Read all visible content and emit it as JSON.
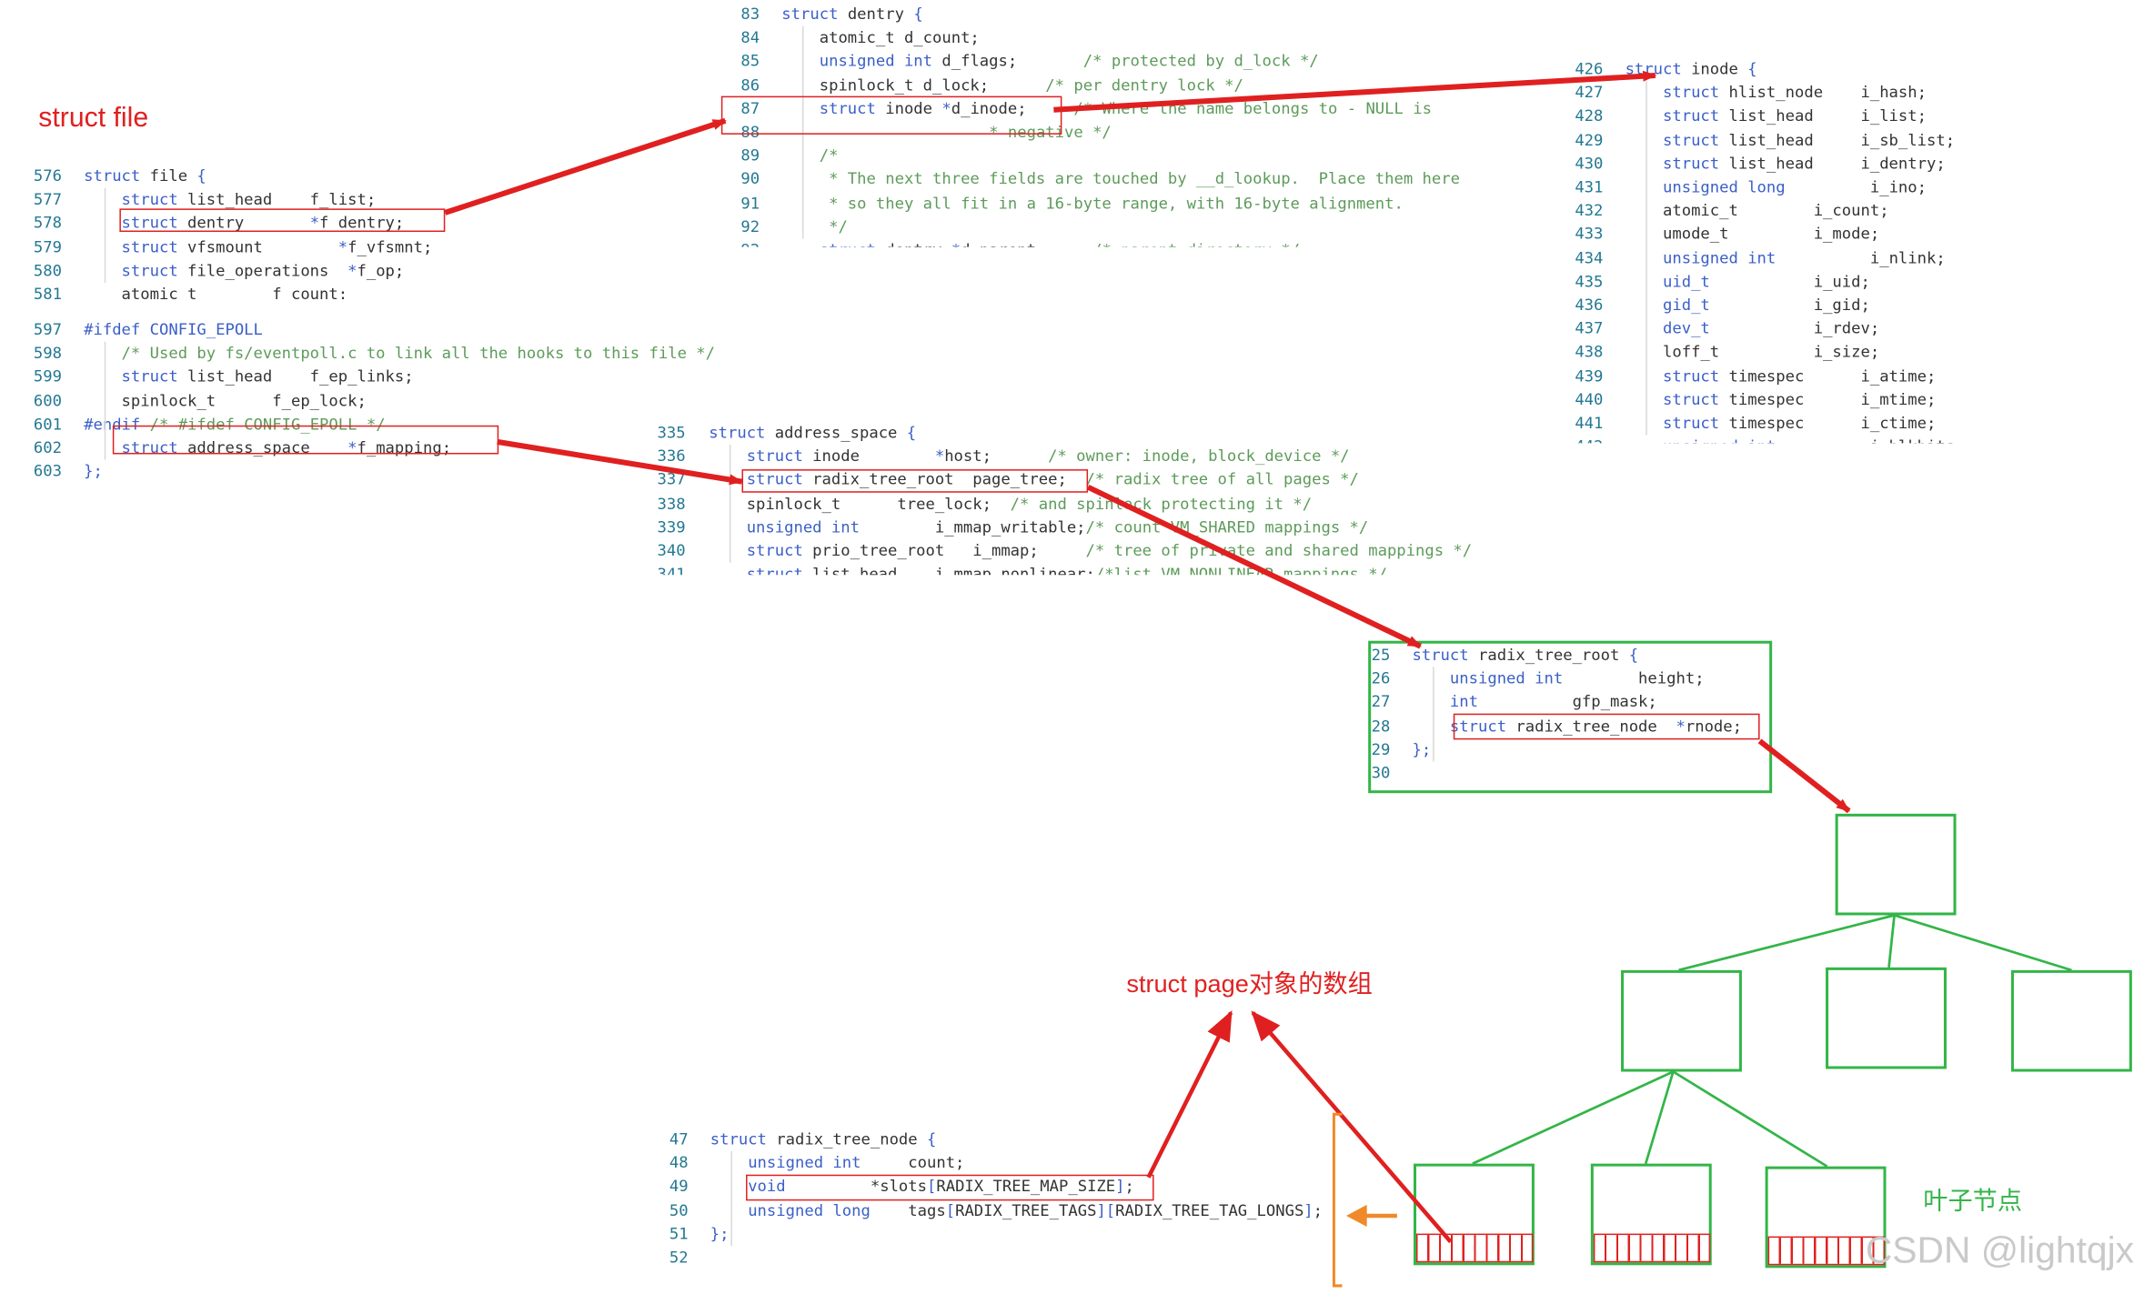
{
  "labels": {
    "struct_file": "struct file",
    "page_array": "struct page对象的数组",
    "leaf_nodes": "叶子节点",
    "watermark": "CSDN @lightqjx"
  },
  "code_blocks": {
    "file_top": [
      {
        "num": "576",
        "parts": [
          {
            "t": "struct",
            "c": "kw"
          },
          {
            "t": " file ",
            "c": ""
          },
          {
            "t": "{",
            "c": "kw"
          }
        ]
      },
      {
        "num": "577",
        "parts": [
          {
            "t": "    struct",
            "c": "kw"
          },
          {
            "t": " list_head    f_list;",
            "c": ""
          }
        ]
      },
      {
        "num": "578",
        "parts": [
          {
            "t": "    struct",
            "c": "kw"
          },
          {
            "t": " dentry       ",
            "c": ""
          },
          {
            "t": "*",
            "c": "kw"
          },
          {
            "t": "f_dentry;",
            "c": ""
          }
        ]
      },
      {
        "num": "579",
        "parts": [
          {
            "t": "    struct",
            "c": "kw"
          },
          {
            "t": " vfsmount        ",
            "c": ""
          },
          {
            "t": "*",
            "c": "kw"
          },
          {
            "t": "f_vfsmnt;",
            "c": ""
          }
        ]
      },
      {
        "num": "580",
        "parts": [
          {
            "t": "    struct",
            "c": "kw"
          },
          {
            "t": " file_operations  ",
            "c": ""
          },
          {
            "t": "*",
            "c": "kw"
          },
          {
            "t": "f_op;",
            "c": ""
          }
        ]
      },
      {
        "num": "581",
        "parts": [
          {
            "t": "    atomic_t        f_count;",
            "c": ""
          }
        ]
      }
    ],
    "file_bottom": [
      {
        "num": "597",
        "parts": [
          {
            "t": "#ifdef CONFIG_EPOLL",
            "c": "kw"
          }
        ]
      },
      {
        "num": "598",
        "parts": [
          {
            "t": "    /* Used by fs/eventpoll.c to link all the hooks to this file */",
            "c": "cm"
          }
        ]
      },
      {
        "num": "599",
        "parts": [
          {
            "t": "    struct",
            "c": "kw"
          },
          {
            "t": " list_head    f_ep_links;",
            "c": ""
          }
        ]
      },
      {
        "num": "600",
        "parts": [
          {
            "t": "    spinlock_t      f_ep_lock;",
            "c": ""
          }
        ]
      },
      {
        "num": "601",
        "parts": [
          {
            "t": "#endif ",
            "c": "kw"
          },
          {
            "t": "/* #ifdef CONFIG_EPOLL */",
            "c": "cm"
          }
        ]
      },
      {
        "num": "602",
        "parts": [
          {
            "t": "    struct",
            "c": "kw"
          },
          {
            "t": " address_space    ",
            "c": ""
          },
          {
            "t": "*",
            "c": "kw"
          },
          {
            "t": "f_mapping;",
            "c": ""
          }
        ]
      },
      {
        "num": "603",
        "parts": [
          {
            "t": "};",
            "c": "kw"
          }
        ]
      }
    ],
    "dentry": [
      {
        "num": "83",
        "parts": [
          {
            "t": "struct",
            "c": "kw"
          },
          {
            "t": " dentry ",
            "c": ""
          },
          {
            "t": "{",
            "c": "kw"
          }
        ]
      },
      {
        "num": "84",
        "parts": [
          {
            "t": "    atomic_t d_count;",
            "c": ""
          }
        ]
      },
      {
        "num": "85",
        "parts": [
          {
            "t": "    unsigned int",
            "c": "kw"
          },
          {
            "t": " d_flags;       ",
            "c": ""
          },
          {
            "t": "/* protected by d_lock */",
            "c": "cm"
          }
        ]
      },
      {
        "num": "86",
        "parts": [
          {
            "t": "    spinlock_t d_lock;      ",
            "c": ""
          },
          {
            "t": "/* per dentry lock */",
            "c": "cm"
          }
        ]
      },
      {
        "num": "87",
        "parts": [
          {
            "t": "    struct",
            "c": "kw"
          },
          {
            "t": " inode ",
            "c": ""
          },
          {
            "t": "*",
            "c": "kw"
          },
          {
            "t": "d_inode;     ",
            "c": ""
          },
          {
            "t": "/* Where the name belongs to - NULL is",
            "c": "cm"
          }
        ]
      },
      {
        "num": "88",
        "parts": [
          {
            "t": "                      ",
            "c": ""
          },
          {
            "t": "* negative */",
            "c": "cm"
          }
        ]
      },
      {
        "num": "89",
        "parts": [
          {
            "t": "    /*",
            "c": "cm"
          }
        ]
      },
      {
        "num": "90",
        "parts": [
          {
            "t": "     * The next three fields are touched by __d_lookup.  Place them here",
            "c": "cm"
          }
        ]
      },
      {
        "num": "91",
        "parts": [
          {
            "t": "     * so they all fit in a 16-byte range, with 16-byte alignment.",
            "c": "cm"
          }
        ]
      },
      {
        "num": "92",
        "parts": [
          {
            "t": "     */",
            "c": "cm"
          }
        ]
      },
      {
        "num": "93",
        "parts": [
          {
            "t": "    struct",
            "c": "kw"
          },
          {
            "t": " dentry ",
            "c": ""
          },
          {
            "t": "*",
            "c": "kw"
          },
          {
            "t": "d_parent;     ",
            "c": ""
          },
          {
            "t": "/* parent directory */",
            "c": "cm"
          }
        ]
      }
    ],
    "inode": [
      {
        "num": "426",
        "parts": [
          {
            "t": "struct",
            "c": "kw"
          },
          {
            "t": " inode ",
            "c": ""
          },
          {
            "t": "{",
            "c": "kw"
          }
        ]
      },
      {
        "num": "427",
        "parts": [
          {
            "t": "    struct",
            "c": "kw"
          },
          {
            "t": " hlist_node    i_hash;",
            "c": ""
          }
        ]
      },
      {
        "num": "428",
        "parts": [
          {
            "t": "    struct",
            "c": "kw"
          },
          {
            "t": " list_head     i_list;",
            "c": ""
          }
        ]
      },
      {
        "num": "429",
        "parts": [
          {
            "t": "    struct",
            "c": "kw"
          },
          {
            "t": " list_head     i_sb_list;",
            "c": ""
          }
        ]
      },
      {
        "num": "430",
        "parts": [
          {
            "t": "    struct",
            "c": "kw"
          },
          {
            "t": " list_head     i_dentry;",
            "c": ""
          }
        ]
      },
      {
        "num": "431",
        "parts": [
          {
            "t": "    unsigned long",
            "c": "kw"
          },
          {
            "t": "         i_ino;",
            "c": ""
          }
        ]
      },
      {
        "num": "432",
        "parts": [
          {
            "t": "    atomic_t        i_count;",
            "c": ""
          }
        ]
      },
      {
        "num": "433",
        "parts": [
          {
            "t": "    umode_t         i_mode;",
            "c": ""
          }
        ]
      },
      {
        "num": "434",
        "parts": [
          {
            "t": "    unsigned int",
            "c": "kw"
          },
          {
            "t": "          i_nlink;",
            "c": ""
          }
        ]
      },
      {
        "num": "435",
        "parts": [
          {
            "t": "    uid_t",
            "c": "kw"
          },
          {
            "t": "           i_uid;",
            "c": ""
          }
        ]
      },
      {
        "num": "436",
        "parts": [
          {
            "t": "    gid_t",
            "c": "kw"
          },
          {
            "t": "           i_gid;",
            "c": ""
          }
        ]
      },
      {
        "num": "437",
        "parts": [
          {
            "t": "    dev_t",
            "c": "kw"
          },
          {
            "t": "           i_rdev;",
            "c": ""
          }
        ]
      },
      {
        "num": "438",
        "parts": [
          {
            "t": "    loff_t          i_size;",
            "c": ""
          }
        ]
      },
      {
        "num": "439",
        "parts": [
          {
            "t": "    struct",
            "c": "kw"
          },
          {
            "t": " timespec      i_atime;",
            "c": ""
          }
        ]
      },
      {
        "num": "440",
        "parts": [
          {
            "t": "    struct",
            "c": "kw"
          },
          {
            "t": " timespec      i_mtime;",
            "c": ""
          }
        ]
      },
      {
        "num": "441",
        "parts": [
          {
            "t": "    struct",
            "c": "kw"
          },
          {
            "t": " timespec      i_ctime;",
            "c": ""
          }
        ]
      },
      {
        "num": "442",
        "parts": [
          {
            "t": "    unsigned int",
            "c": "kw"
          },
          {
            "t": "          i_blkbits;",
            "c": ""
          }
        ]
      }
    ],
    "address_space": [
      {
        "num": "335",
        "parts": [
          {
            "t": "struct",
            "c": "kw"
          },
          {
            "t": " address_space ",
            "c": ""
          },
          {
            "t": "{",
            "c": "kw"
          }
        ]
      },
      {
        "num": "336",
        "parts": [
          {
            "t": "    struct",
            "c": "kw"
          },
          {
            "t": " inode        ",
            "c": ""
          },
          {
            "t": "*",
            "c": "kw"
          },
          {
            "t": "host;      ",
            "c": ""
          },
          {
            "t": "/* owner: inode, block_device */",
            "c": "cm"
          }
        ]
      },
      {
        "num": "337",
        "parts": [
          {
            "t": "    struct",
            "c": "kw"
          },
          {
            "t": " radix_tree_root  page_tree;  ",
            "c": ""
          },
          {
            "t": "/* radix tree of all pages */",
            "c": "cm"
          }
        ]
      },
      {
        "num": "338",
        "parts": [
          {
            "t": "    spinlock_t      tree_lock;  ",
            "c": ""
          },
          {
            "t": "/* and spinlock protecting it */",
            "c": "cm"
          }
        ]
      },
      {
        "num": "339",
        "parts": [
          {
            "t": "    unsigned int",
            "c": "kw"
          },
          {
            "t": "        i_mmap_writable;",
            "c": ""
          },
          {
            "t": "/* count VM_SHARED mappings */",
            "c": "cm"
          }
        ]
      },
      {
        "num": "340",
        "parts": [
          {
            "t": "    struct",
            "c": "kw"
          },
          {
            "t": " prio_tree_root   i_mmap;     ",
            "c": ""
          },
          {
            "t": "/* tree of private and shared mappings */",
            "c": "cm"
          }
        ]
      },
      {
        "num": "341",
        "parts": [
          {
            "t": "    struct",
            "c": "kw"
          },
          {
            "t": " list_head    i_mmap_nonlinear;",
            "c": ""
          },
          {
            "t": "/*list VM_NONLINEAR mappings */",
            "c": "cm"
          }
        ]
      }
    ],
    "radix_root": [
      {
        "num": "25",
        "parts": [
          {
            "t": "struct",
            "c": "kw"
          },
          {
            "t": " radix_tree_root ",
            "c": ""
          },
          {
            "t": "{",
            "c": "kw"
          }
        ]
      },
      {
        "num": "26",
        "parts": [
          {
            "t": "    unsigned int",
            "c": "kw"
          },
          {
            "t": "        height;",
            "c": ""
          }
        ]
      },
      {
        "num": "27",
        "parts": [
          {
            "t": "    int",
            "c": "kw"
          },
          {
            "t": "          gfp_mask;",
            "c": ""
          }
        ]
      },
      {
        "num": "28",
        "parts": [
          {
            "t": "    struct",
            "c": "kw"
          },
          {
            "t": " radix_tree_node  ",
            "c": ""
          },
          {
            "t": "*",
            "c": "kw"
          },
          {
            "t": "rnode;",
            "c": ""
          }
        ]
      },
      {
        "num": "29",
        "parts": [
          {
            "t": "};",
            "c": "kw"
          }
        ]
      },
      {
        "num": "30",
        "parts": []
      }
    ],
    "radix_node": [
      {
        "num": "47",
        "parts": [
          {
            "t": "struct",
            "c": "kw"
          },
          {
            "t": " radix_tree_node ",
            "c": ""
          },
          {
            "t": "{",
            "c": "kw"
          }
        ]
      },
      {
        "num": "48",
        "parts": [
          {
            "t": "    unsigned int",
            "c": "kw"
          },
          {
            "t": "     count;",
            "c": ""
          }
        ]
      },
      {
        "num": "49",
        "parts": [
          {
            "t": "    void",
            "c": "kw"
          },
          {
            "t": "         *slots",
            "c": ""
          },
          {
            "t": "[",
            "c": "kw"
          },
          {
            "t": "RADIX_TREE_MAP_SIZE",
            "c": ""
          },
          {
            "t": "]",
            "c": "kw"
          },
          {
            "t": ";",
            "c": ""
          }
        ]
      },
      {
        "num": "50",
        "parts": [
          {
            "t": "    unsigned long",
            "c": "kw"
          },
          {
            "t": "    tags",
            "c": ""
          },
          {
            "t": "[",
            "c": "kw"
          },
          {
            "t": "RADIX_TREE_TAGS",
            "c": ""
          },
          {
            "t": "][",
            "c": "kw"
          },
          {
            "t": "RADIX_TREE_TAG_LONGS",
            "c": ""
          },
          {
            "t": "]",
            "c": "kw"
          },
          {
            "t": ";",
            "c": ""
          }
        ]
      },
      {
        "num": "51",
        "parts": [
          {
            "t": "};",
            "c": "kw"
          }
        ]
      },
      {
        "num": "52",
        "parts": []
      }
    ]
  },
  "colors": {
    "pointer_arrow": "#e02020",
    "tree": "#33b548",
    "bracket": "#f0892a",
    "keyword": "#3a5fc8",
    "comment": "#5d9b5a",
    "line_number": "#237893"
  }
}
